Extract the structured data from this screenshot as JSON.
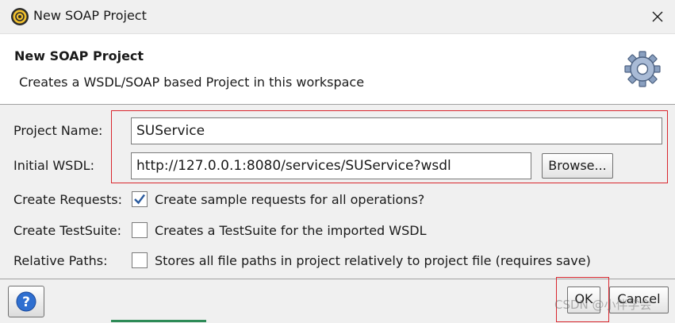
{
  "window": {
    "title": "New SOAP Project"
  },
  "banner": {
    "title": "New SOAP Project",
    "description": "Creates a WSDL/SOAP based Project in this workspace"
  },
  "form": {
    "project_name_label": "Project Name:",
    "project_name_value": "SUService",
    "initial_wsdl_label": "Initial WSDL:",
    "initial_wsdl_value": "http://127.0.0.1:8080/services/SUService?wsdl",
    "browse_label": "Browse...",
    "create_requests_label": "Create Requests:",
    "create_requests_text": "Create sample requests for all operations?",
    "create_requests_checked": true,
    "create_testsuite_label": "Create TestSuite:",
    "create_testsuite_text": "Creates a TestSuite for the imported WSDL",
    "create_testsuite_checked": false,
    "relative_paths_label": "Relative Paths:",
    "relative_paths_text": "Stores all file paths in project relatively to project file (requires save)",
    "relative_paths_checked": false
  },
  "footer": {
    "ok_label": "OK",
    "cancel_label": "Cancel",
    "watermark": "CSDN @小伴学会"
  },
  "colors": {
    "highlight": "#d9272e",
    "check": "#2a5a9e",
    "help": "#2f6fd0"
  }
}
